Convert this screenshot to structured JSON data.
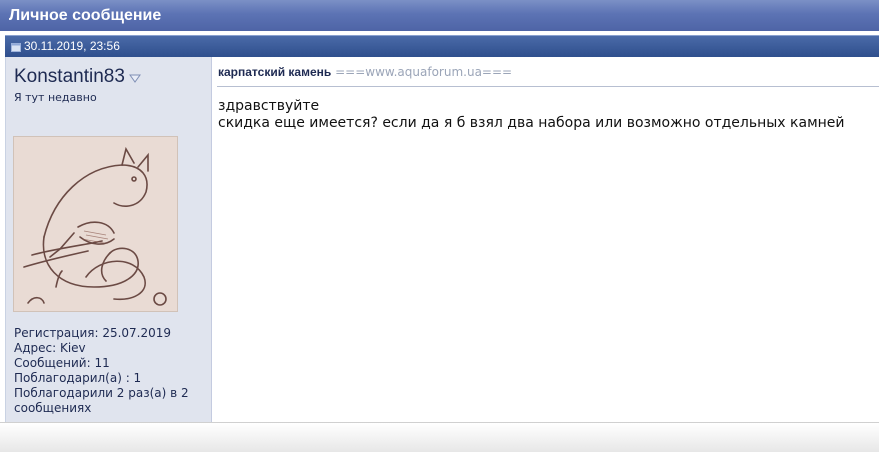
{
  "header": {
    "title": "Личное сообщение",
    "color": "#5c73b4"
  },
  "post_meta": {
    "date": "30.11.2019, 23:56",
    "icon": "post-icon"
  },
  "user": {
    "username": "Konstantin83",
    "dropdown_icon": "chevron-down-icon",
    "title": "Я тут недавно",
    "avatar": "avatar-cat-drawing",
    "stats": [
      "Регистрация: 25.07.2019",
      "Адрес: Kiev",
      "Сообщений: 11",
      "Поблагодарил(а) : 1",
      "Поблагодарили 2 раз(а) в 2 сообщениях"
    ]
  },
  "message": {
    "subject": "карпатский камень",
    "watermark": "===www.aquaforum.ua===",
    "lines": [
      "здравствуйте",
      "скидка еще имеется? если да я б взял два набора или возможно отдельных камней"
    ]
  }
}
